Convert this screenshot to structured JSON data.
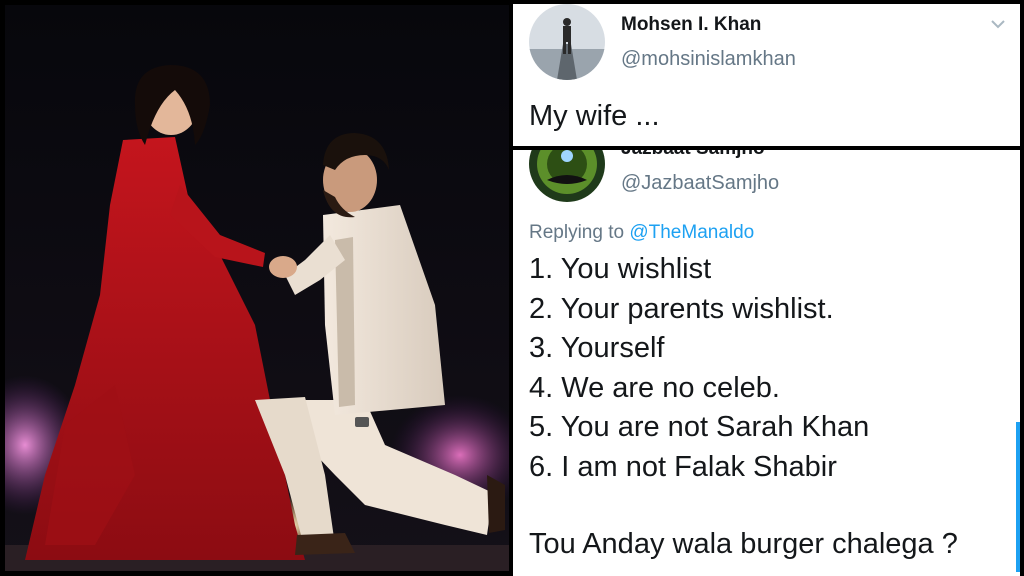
{
  "tweet1": {
    "display_name": "Mohsen I. Khan",
    "handle": "@mohsinislamkhan",
    "body": "My wife ..."
  },
  "tweet2": {
    "display_name_clipped": "Jazbaat Samjho",
    "handle": "@JazbaatSamjho",
    "replying_prefix": "Replying to",
    "replying_to": "@TheManaldo",
    "list": [
      "1. You wishlist",
      "2. Your parents wishlist.",
      "3. Yourself",
      "4. We are no celeb.",
      "5. You are not Sarah Khan",
      "6. I am not Falak Shabir"
    ],
    "closing": "Tou Anday wala burger chalega ?"
  },
  "colors": {
    "text_primary": "#14171a",
    "text_secondary": "#657786",
    "link": "#1da1f2",
    "dress_red": "#b3141c"
  },
  "icons": [
    "chevron-down-icon"
  ]
}
